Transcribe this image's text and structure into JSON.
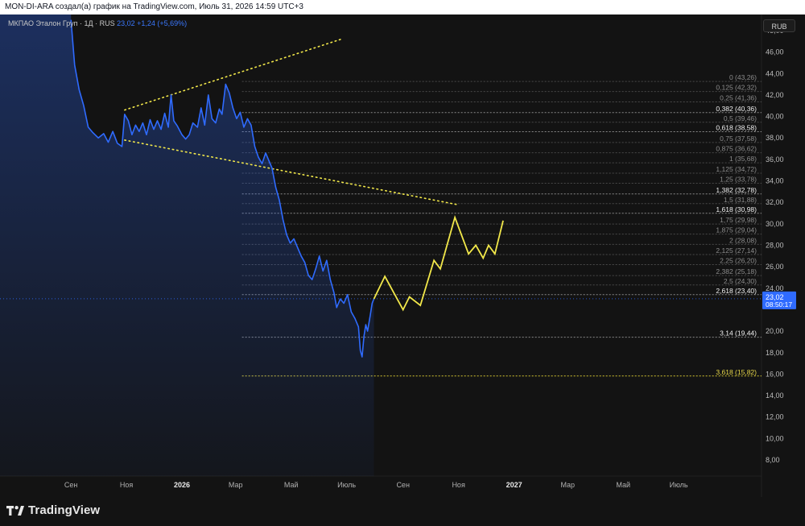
{
  "header": {
    "caption": "MON-DI-ARA создал(а) график на TradingView.com, Июль 31, 2026 14:59 UTC+3"
  },
  "legend": {
    "symbol": "МКПАО Эталон Груп · 1Д · RUS",
    "values": "23,02 +1,24 (+5,69%)"
  },
  "currency_label": "RUB",
  "footer": {
    "brand": "TradingView"
  },
  "colors": {
    "price_line": "#2f6bff",
    "projection": "#f2e84a",
    "background": "#131313",
    "fib_line": "#555555"
  },
  "chart_data": {
    "type": "line",
    "ylim": [
      6.5,
      49.5
    ],
    "y_ticks": [
      {
        "value": 48,
        "label": "48,00"
      },
      {
        "value": 46,
        "label": "46,00"
      },
      {
        "value": 44,
        "label": "44,00"
      },
      {
        "value": 42,
        "label": "42,00"
      },
      {
        "value": 40,
        "label": "40,00"
      },
      {
        "value": 38,
        "label": "38,00"
      },
      {
        "value": 36,
        "label": "36,00"
      },
      {
        "value": 34,
        "label": "34,00"
      },
      {
        "value": 32,
        "label": "32,00"
      },
      {
        "value": 30,
        "label": "30,00"
      },
      {
        "value": 28,
        "label": "28,00"
      },
      {
        "value": 26,
        "label": "26,00"
      },
      {
        "value": 24,
        "label": "24,00"
      },
      {
        "value": 20,
        "label": "20,00"
      },
      {
        "value": 18,
        "label": "18,00"
      },
      {
        "value": 16,
        "label": "16,00"
      },
      {
        "value": 14,
        "label": "14,00"
      },
      {
        "value": 12,
        "label": "12,00"
      },
      {
        "value": 10,
        "label": "10,00"
      },
      {
        "value": 8,
        "label": "8,00"
      }
    ],
    "x_ticks": [
      {
        "date": "2025-05-01",
        "label": "Май"
      },
      {
        "date": "2025-09-01",
        "label": "Сен"
      },
      {
        "date": "2025-11-01",
        "label": "Ноя"
      },
      {
        "date": "2026-01-01",
        "label": "2026",
        "bold": true
      },
      {
        "date": "2026-03-01",
        "label": "Мар"
      },
      {
        "date": "2026-05-01",
        "label": "Май"
      },
      {
        "date": "2026-07-01",
        "label": "Июль"
      },
      {
        "date": "2026-09-01",
        "label": "Сен"
      },
      {
        "date": "2026-11-01",
        "label": "Ноя"
      },
      {
        "date": "2027-01-01",
        "label": "2027",
        "bold": true
      },
      {
        "date": "2027-03-01",
        "label": "Мар"
      },
      {
        "date": "2027-05-01",
        "label": "Май"
      },
      {
        "date": "2027-07-01",
        "label": "Июль"
      }
    ],
    "x_range": [
      "2025-06-15",
      "2027-09-30"
    ],
    "last_price": {
      "value": 23.02,
      "label": "23,02",
      "time": "08:50:17"
    },
    "series": [
      {
        "id": "price",
        "points": [
          [
            "2025-09-01",
            49.0
          ],
          [
            "2025-09-05",
            44.8
          ],
          [
            "2025-09-10",
            42.5
          ],
          [
            "2025-09-15",
            41.0
          ],
          [
            "2025-09-20",
            39.0
          ],
          [
            "2025-09-25",
            38.5
          ],
          [
            "2025-10-01",
            38.0
          ],
          [
            "2025-10-07",
            38.4
          ],
          [
            "2025-10-12",
            37.6
          ],
          [
            "2025-10-17",
            38.6
          ],
          [
            "2025-10-22",
            37.5
          ],
          [
            "2025-10-27",
            37.2
          ],
          [
            "2025-10-30",
            40.2
          ],
          [
            "2025-11-03",
            39.6
          ],
          [
            "2025-11-07",
            38.3
          ],
          [
            "2025-11-11",
            39.2
          ],
          [
            "2025-11-15",
            38.6
          ],
          [
            "2025-11-19",
            39.4
          ],
          [
            "2025-11-23",
            38.3
          ],
          [
            "2025-11-27",
            39.7
          ],
          [
            "2025-12-01",
            38.8
          ],
          [
            "2025-12-05",
            39.6
          ],
          [
            "2025-12-09",
            38.8
          ],
          [
            "2025-12-13",
            40.3
          ],
          [
            "2025-12-17",
            39.0
          ],
          [
            "2025-12-20",
            42.0
          ],
          [
            "2025-12-23",
            39.6
          ],
          [
            "2025-12-27",
            39.1
          ],
          [
            "2026-01-01",
            38.3
          ],
          [
            "2026-01-05",
            37.9
          ],
          [
            "2026-01-09",
            38.3
          ],
          [
            "2026-01-13",
            39.4
          ],
          [
            "2026-01-18",
            39.0
          ],
          [
            "2026-01-22",
            40.8
          ],
          [
            "2026-01-26",
            39.2
          ],
          [
            "2026-01-30",
            42.0
          ],
          [
            "2026-02-03",
            39.8
          ],
          [
            "2026-02-07",
            39.4
          ],
          [
            "2026-02-11",
            40.7
          ],
          [
            "2026-02-14",
            40.2
          ],
          [
            "2026-02-18",
            43.0
          ],
          [
            "2026-02-22",
            42.2
          ],
          [
            "2026-02-26",
            40.8
          ],
          [
            "2026-03-02",
            39.8
          ],
          [
            "2026-03-06",
            40.4
          ],
          [
            "2026-03-10",
            39.0
          ],
          [
            "2026-03-14",
            39.8
          ],
          [
            "2026-03-18",
            39.2
          ],
          [
            "2026-03-22",
            37.2
          ],
          [
            "2026-03-26",
            36.2
          ],
          [
            "2026-03-30",
            35.6
          ],
          [
            "2026-04-03",
            36.6
          ],
          [
            "2026-04-07",
            35.8
          ],
          [
            "2026-04-10",
            35.2
          ],
          [
            "2026-04-14",
            33.4
          ],
          [
            "2026-04-18",
            32.2
          ],
          [
            "2026-04-22",
            30.4
          ],
          [
            "2026-04-26",
            29.0
          ],
          [
            "2026-04-30",
            28.2
          ],
          [
            "2026-05-04",
            28.6
          ],
          [
            "2026-05-08",
            27.8
          ],
          [
            "2026-05-12",
            27.0
          ],
          [
            "2026-05-16",
            26.4
          ],
          [
            "2026-05-20",
            25.2
          ],
          [
            "2026-05-24",
            24.8
          ],
          [
            "2026-05-28",
            25.8
          ],
          [
            "2026-06-01",
            27.0
          ],
          [
            "2026-06-05",
            25.6
          ],
          [
            "2026-06-09",
            26.6
          ],
          [
            "2026-06-13",
            24.8
          ],
          [
            "2026-06-17",
            23.6
          ],
          [
            "2026-06-20",
            22.2
          ],
          [
            "2026-06-24",
            23.0
          ],
          [
            "2026-06-28",
            22.6
          ],
          [
            "2026-07-02",
            23.4
          ],
          [
            "2026-07-06",
            21.8
          ],
          [
            "2026-07-10",
            21.2
          ],
          [
            "2026-07-14",
            20.4
          ],
          [
            "2026-07-16",
            18.2
          ],
          [
            "2026-07-18",
            17.6
          ],
          [
            "2026-07-20",
            19.5
          ],
          [
            "2026-07-22",
            20.6
          ],
          [
            "2026-07-24",
            20.0
          ],
          [
            "2026-07-27",
            21.5
          ],
          [
            "2026-07-29",
            22.6
          ],
          [
            "2026-07-31",
            23.02
          ]
        ]
      },
      {
        "id": "projection",
        "points": [
          [
            "2026-07-31",
            23.0
          ],
          [
            "2026-08-12",
            25.1
          ],
          [
            "2026-09-01",
            22.0
          ],
          [
            "2026-09-08",
            23.2
          ],
          [
            "2026-09-20",
            22.4
          ],
          [
            "2026-10-05",
            26.6
          ],
          [
            "2026-10-12",
            25.8
          ],
          [
            "2026-10-28",
            30.6
          ],
          [
            "2026-11-12",
            27.2
          ],
          [
            "2026-11-20",
            28.0
          ],
          [
            "2026-11-28",
            26.8
          ],
          [
            "2026-12-04",
            28.0
          ],
          [
            "2026-12-11",
            27.2
          ],
          [
            "2026-12-20",
            30.3
          ]
        ]
      }
    ],
    "trendlines": [
      {
        "from": [
          "2025-10-30",
          40.6
        ],
        "to": [
          "2026-06-25",
          47.2
        ]
      },
      {
        "from": [
          "2025-10-30",
          37.8
        ],
        "to": [
          "2026-10-30",
          31.8
        ]
      }
    ],
    "fib_start": "2026-03-08",
    "fib_levels": [
      {
        "value": 43.26,
        "label": "0 (43,26)",
        "style": "dim"
      },
      {
        "value": 42.32,
        "label": "0,125 (42,32)",
        "style": "dim"
      },
      {
        "value": 41.36,
        "label": "0,25 (41,36)",
        "style": "dim"
      },
      {
        "value": 40.36,
        "label": "0,382 (40,36)",
        "style": "key"
      },
      {
        "value": 39.46,
        "label": "0,5 (39,46)",
        "style": "dim"
      },
      {
        "value": 38.58,
        "label": "0,618 (38,58)",
        "style": "key"
      },
      {
        "value": 37.58,
        "label": "0,75 (37,58)",
        "style": "dim"
      },
      {
        "value": 36.62,
        "label": "0,875 (36,62)",
        "style": "dim"
      },
      {
        "value": 35.68,
        "label": "1 (35,68)",
        "style": "dim"
      },
      {
        "value": 34.72,
        "label": "1,125 (34,72)",
        "style": "dim"
      },
      {
        "value": 33.78,
        "label": "1,25 (33,78)",
        "style": "dim"
      },
      {
        "value": 32.78,
        "label": "1,382 (32,78)",
        "style": "key"
      },
      {
        "value": 31.88,
        "label": "1,5 (31,88)",
        "style": "dim"
      },
      {
        "value": 30.98,
        "label": "1,618 (30,98)",
        "style": "key"
      },
      {
        "value": 29.98,
        "label": "1,75 (29,98)",
        "style": "dim"
      },
      {
        "value": 29.04,
        "label": "1,875 (29,04)",
        "style": "dim"
      },
      {
        "value": 28.08,
        "label": "2 (28,08)",
        "style": "dim"
      },
      {
        "value": 27.14,
        "label": "2,125 (27,14)",
        "style": "dim"
      },
      {
        "value": 26.2,
        "label": "2,25 (26,20)",
        "style": "dim"
      },
      {
        "value": 25.18,
        "label": "2,382 (25,18)",
        "style": "dim"
      },
      {
        "value": 24.3,
        "label": "2,5 (24,30)",
        "style": "dim"
      },
      {
        "value": 23.4,
        "label": "2,618 (23,40)",
        "style": "key"
      },
      {
        "value": 19.44,
        "label": "3,14 (19,44)",
        "style": "key"
      },
      {
        "value": 15.82,
        "label": "3,618 (15,82)",
        "style": "gold"
      }
    ]
  }
}
